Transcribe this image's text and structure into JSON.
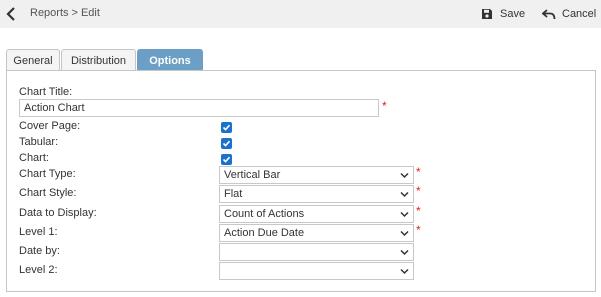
{
  "breadcrumb": {
    "parent": "Reports",
    "separator": ">",
    "current": "Edit"
  },
  "toolbar": {
    "save_label": "Save",
    "cancel_label": "Cancel"
  },
  "tabs": [
    {
      "label": "General",
      "active": false
    },
    {
      "label": "Distribution",
      "active": false
    },
    {
      "label": "Options",
      "active": true
    }
  ],
  "form": {
    "chart_title": {
      "label": "Chart Title:",
      "value": "Action Chart",
      "required": true
    },
    "cover_page": {
      "label": "Cover Page:",
      "checked": true
    },
    "tabular": {
      "label": "Tabular:",
      "checked": true
    },
    "chart": {
      "label": "Chart:",
      "checked": true
    },
    "chart_type": {
      "label": "Chart Type:",
      "value": "Vertical Bar",
      "required": true
    },
    "chart_style": {
      "label": "Chart Style:",
      "value": "Flat",
      "required": true
    },
    "data_to_display": {
      "label": "Data to Display:",
      "value": "Count of Actions",
      "required": true
    },
    "level_1": {
      "label": "Level 1:",
      "value": "Action Due Date",
      "required": true
    },
    "date_by": {
      "label": "Date by:",
      "value": ""
    },
    "level_2": {
      "label": "Level 2:",
      "value": ""
    }
  },
  "required_mark": "*",
  "colors": {
    "accent_tab": "#6b9fc5",
    "checkbox": "#1a73c8",
    "required": "#e02020",
    "toolbar_bg": "#f0f0f0"
  },
  "icons": {
    "back": "chevron-left-icon",
    "save": "floppy-disk-icon",
    "cancel": "undo-arrow-icon",
    "dropdown": "chevron-down-icon",
    "check": "checkmark-icon"
  }
}
